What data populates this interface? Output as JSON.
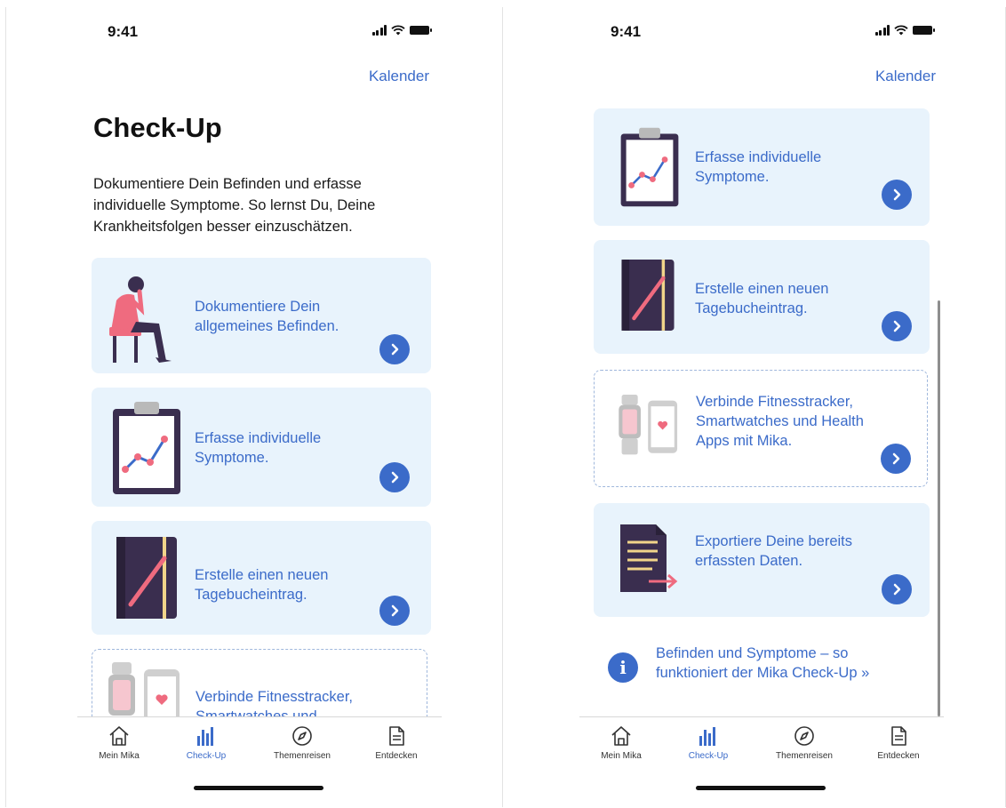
{
  "status_bar": {
    "time": "9:41"
  },
  "header": {
    "calendar_link": "Kalender"
  },
  "checkup": {
    "title": "Check-Up",
    "intro": "Dokumentiere Dein Befinden und erfasse individuelle Symptome. So lernst Du, Deine Krankheitsfolgen besser einzuschätzen."
  },
  "cards": {
    "befinden": "Dokumentiere Dein allgemeines Befinden.",
    "symptome": "Erfasse individuelle Symptome.",
    "tagebuch": "Erstelle einen neuen Tagebucheintrag.",
    "fitness": "Verbinde Fitnesstracker, Smartwatches und Health Apps mit Mika.",
    "fitness_partial": "Verbinde Fitnesstracker, Smartwatches und",
    "export": "Exportiere Deine bereits erfassten Daten."
  },
  "info": {
    "text": "Befinden und Symptome – so funktioniert der Mika Check-Up »"
  },
  "tabbar": {
    "tabs": [
      {
        "label": "Mein Mika",
        "icon": "home-icon"
      },
      {
        "label": "Check-Up",
        "icon": "bar-chart-icon",
        "active": true
      },
      {
        "label": "Themenreisen",
        "icon": "compass-icon"
      },
      {
        "label": "Entdecken",
        "icon": "document-icon"
      }
    ]
  },
  "colors": {
    "accent": "#3b6bc9",
    "card_bg": "#e8f3fc",
    "dark_illustration": "#3a2e4f",
    "pink": "#ef6b7f"
  }
}
